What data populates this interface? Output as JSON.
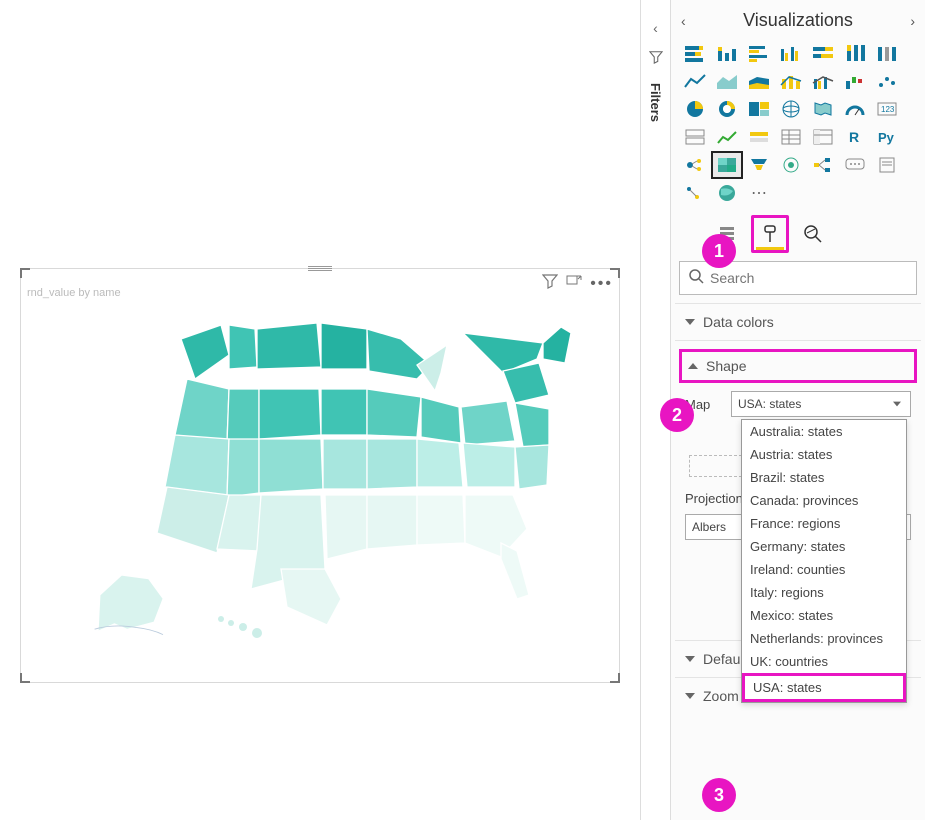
{
  "filters": {
    "label": "Filters"
  },
  "panel": {
    "title": "Visualizations",
    "search_placeholder": "Search"
  },
  "viz_gallery": {
    "selected_index": 29
  },
  "viz_on_canvas": {
    "title": "rnd_value by name"
  },
  "format": {
    "sections": {
      "data_colors": {
        "label": "Data colors",
        "expanded": false
      },
      "shape": {
        "label": "Shape",
        "expanded": true,
        "map_label": "Map",
        "map_selected": "USA: states",
        "map_options": [
          "Australia: states",
          "Austria: states",
          "Brazil: states",
          "Canada: provinces",
          "France: regions",
          "Germany: states",
          "Ireland: counties",
          "Italy: regions",
          "Mexico: states",
          "Netherlands: provinces",
          "UK: countries",
          "USA: states"
        ],
        "projection_label": "Projection",
        "projection_value": "Albers"
      },
      "default": {
        "label": "Default",
        "expanded": false
      },
      "zoom": {
        "label": "Zoom",
        "expanded": false
      }
    }
  },
  "callouts": {
    "c1": "1",
    "c2": "2",
    "c3": "3"
  }
}
